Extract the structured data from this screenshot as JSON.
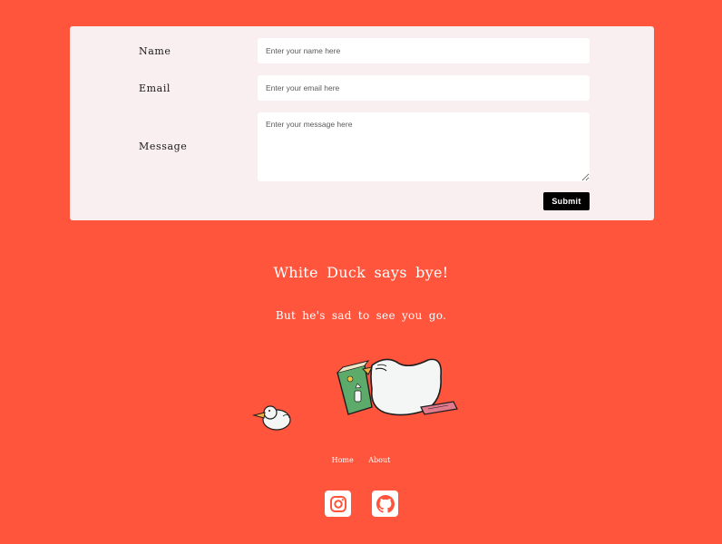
{
  "contact_form": {
    "name_label": "Name",
    "name_placeholder": "Enter your name here",
    "email_label": "Email",
    "email_placeholder": "Enter your email here",
    "message_label": "Message",
    "message_placeholder": "Enter your message here",
    "submit_label": "Submit"
  },
  "farewell": {
    "title": "White Duck says bye!",
    "subtitle": "But he's sad to see you go."
  },
  "footer": {
    "nav": [
      {
        "label": "Home"
      },
      {
        "label": "About"
      }
    ],
    "social": [
      {
        "icon": "instagram-icon"
      },
      {
        "icon": "github-icon"
      }
    ]
  },
  "colors": {
    "background": "#ff553d",
    "card": "#f9eff0",
    "button": "#000000"
  }
}
